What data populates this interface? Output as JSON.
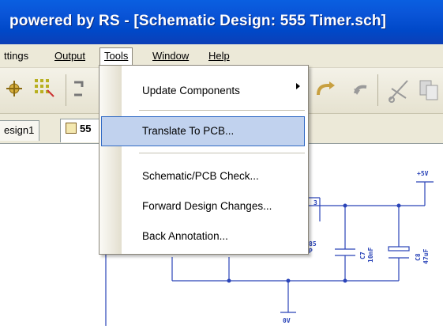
{
  "window": {
    "title": "powered by RS - [Schematic Design: 555 Timer.sch]"
  },
  "menubar": {
    "items": [
      {
        "label": "ttings",
        "active": false
      },
      {
        "label": "Output",
        "active": false
      },
      {
        "label": "Tools",
        "active": true
      },
      {
        "label": "Window",
        "active": false
      },
      {
        "label": "Help",
        "active": false
      }
    ]
  },
  "tabs": [
    {
      "label": "esign1"
    },
    {
      "label": "55"
    }
  ],
  "tools_menu": {
    "items": [
      {
        "label": "Update Components",
        "has_submenu": true
      },
      {
        "label": "Translate To PCB...",
        "highlighted": true
      },
      {
        "label": "Schematic/PCB Check..."
      },
      {
        "label": "Forward Design Changes..."
      },
      {
        "label": "Back Annotation..."
      }
    ]
  },
  "schematic": {
    "labels": {
      "vplus": "+5V",
      "pin3": "3",
      "part_name_1": "85",
      "part_name_2": "P",
      "cap_c7_ref": "C7",
      "cap_c7_val": "10nF",
      "cap_c8_ref": "C8",
      "cap_c8_val": "47uF",
      "ground": "0V"
    }
  },
  "colors": {
    "titlebar": "#0a55d8",
    "menu_bg": "#ece9d8",
    "highlight": "#c1d2ee",
    "highlight_border": "#316ac5",
    "wire": "#2a44b8"
  }
}
